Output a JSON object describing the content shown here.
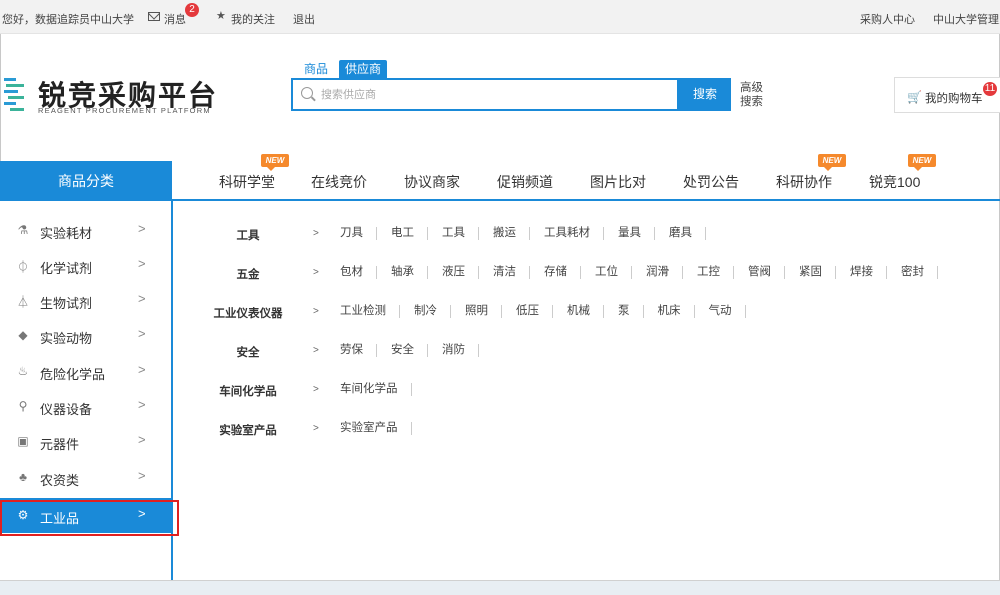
{
  "topbar": {
    "greeting": "您好，数据追踪员",
    "org": "中山大学",
    "messages_label": "消息",
    "messages_count": "2",
    "follow_label": "我的关注",
    "logout_label": "退出",
    "buyer_center": "采购人中心",
    "org_manager": "中山大学管理员"
  },
  "header": {
    "logo_title": "锐竞采购平台",
    "logo_subtitle": "REAGENT PROCUREMENT PLATFORM",
    "search_tabs": [
      "商品",
      "供应商"
    ],
    "search_placeholder": "搜索供应商",
    "search_button": "搜索",
    "advanced_search": "高级搜索",
    "cart_label": "我的购物车",
    "cart_count": "11"
  },
  "nav": {
    "category_header": "商品分类",
    "items": [
      {
        "label": "科研学堂",
        "badge": "NEW"
      },
      {
        "label": "在线竞价",
        "badge": ""
      },
      {
        "label": "协议商家",
        "badge": ""
      },
      {
        "label": "促销频道",
        "badge": ""
      },
      {
        "label": "图片比对",
        "badge": ""
      },
      {
        "label": "处罚公告",
        "badge": ""
      },
      {
        "label": "科研协作",
        "badge": "NEW"
      },
      {
        "label": "锐竞100",
        "badge": "NEW"
      }
    ]
  },
  "sidebar": {
    "items": [
      {
        "label": "实验耗材",
        "icon": "test-tube-icon"
      },
      {
        "label": "化学试剂",
        "icon": "flask-icon"
      },
      {
        "label": "生物试剂",
        "icon": "beaker-icon"
      },
      {
        "label": "实验动物",
        "icon": "mouse-icon"
      },
      {
        "label": "危险化学品",
        "icon": "flame-icon"
      },
      {
        "label": "仪器设备",
        "icon": "microscope-icon"
      },
      {
        "label": "元器件",
        "icon": "chip-icon"
      },
      {
        "label": "农资类",
        "icon": "plant-icon"
      },
      {
        "label": "工业品",
        "icon": "gear-icon",
        "active": true
      }
    ]
  },
  "categories": [
    {
      "title": "工具",
      "items": [
        "刀具",
        "电工",
        "工具",
        "搬运",
        "工具耗材",
        "量具",
        "磨具"
      ]
    },
    {
      "title": "五金",
      "items": [
        "包材",
        "轴承",
        "液压",
        "清洁",
        "存储",
        "工位",
        "润滑",
        "工控",
        "管阀",
        "紧固",
        "焊接",
        "密封"
      ]
    },
    {
      "title": "工业仪表仪器",
      "items": [
        "工业检测",
        "制冷",
        "照明",
        "低压",
        "机械",
        "泵",
        "机床",
        "气动"
      ]
    },
    {
      "title": "安全",
      "items": [
        "劳保",
        "安全",
        "消防"
      ]
    },
    {
      "title": "车间化学品",
      "items": [
        "车间化学品"
      ]
    },
    {
      "title": "实验室产品",
      "items": [
        "实验室产品"
      ]
    }
  ],
  "colors": {
    "primary": "#1a8ad8",
    "badge_red": "#e4393c",
    "new_orange": "#f5892c",
    "highlight": "#e02020"
  }
}
